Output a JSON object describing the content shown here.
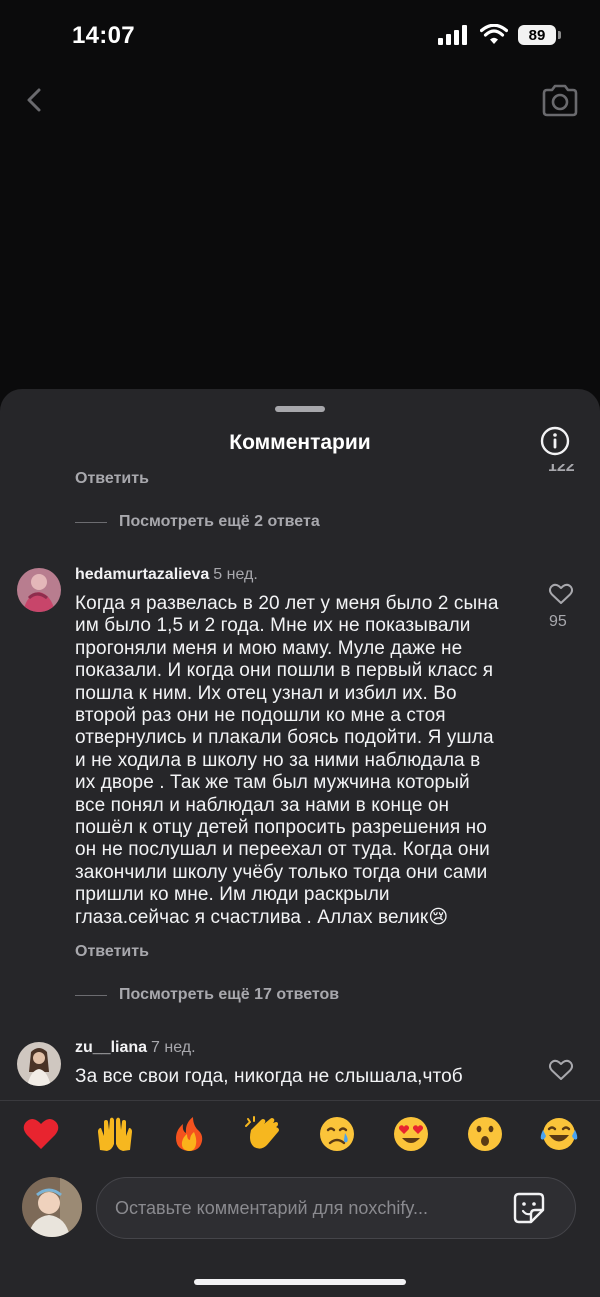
{
  "status_bar": {
    "time": "14:07",
    "battery": "89"
  },
  "sheet": {
    "title": "Комментарии"
  },
  "thread_top": {
    "reply_label": "Ответить",
    "cut_like_count": "122",
    "more_replies": "Посмотреть ещё 2 ответа"
  },
  "comments": [
    {
      "username": "hedamurtazalieva",
      "time": "5 нед.",
      "lines": [
        "Когда я развелась в 20 лет у меня было 2 сына",
        "им было 1,5 и 2 года. Мне их не показывали",
        "прогоняли меня и мою маму. Муле даже не",
        "показали. И когда они пошли в первый класс я",
        "пошла к ним. Их отец узнал и избил их. Во",
        "второй раз они не подошли ко мне а стоя",
        "отвернулись и плакали боясь подойти. Я ушла",
        "и не ходила в школу но за ними наблюдала в",
        "их дворе . Так же там был мужчина который",
        "все понял и наблюдал за нами в конце он",
        "пошёл к отцу детей попросить разрешения но",
        "он не послушал и переехал от туда. Когда они",
        "закончили школу учёбу только тогда они сами",
        "пришли ко мне. Им люди раскрыли",
        "глаза.сейчас я счастлива . Аллах велик😢"
      ],
      "likes": "95",
      "reply_label": "Ответить",
      "more_replies": "Посмотреть ещё 17 ответов"
    },
    {
      "username": "zu__liana",
      "time": "7 нед.",
      "lines": [
        "За все свои года, никогда не слышала,чтоб"
      ]
    }
  ],
  "emoji_bar": [
    "❤️",
    "🙌",
    "🔥",
    "👏",
    "😢",
    "😍",
    "😮",
    "😂"
  ],
  "composer": {
    "placeholder": "Оставьте комментарий для noxchify..."
  },
  "colors": {
    "sheet_bg": "#262629",
    "page_bg": "#0b0b0c",
    "muted_text": "#a8a8ad"
  }
}
